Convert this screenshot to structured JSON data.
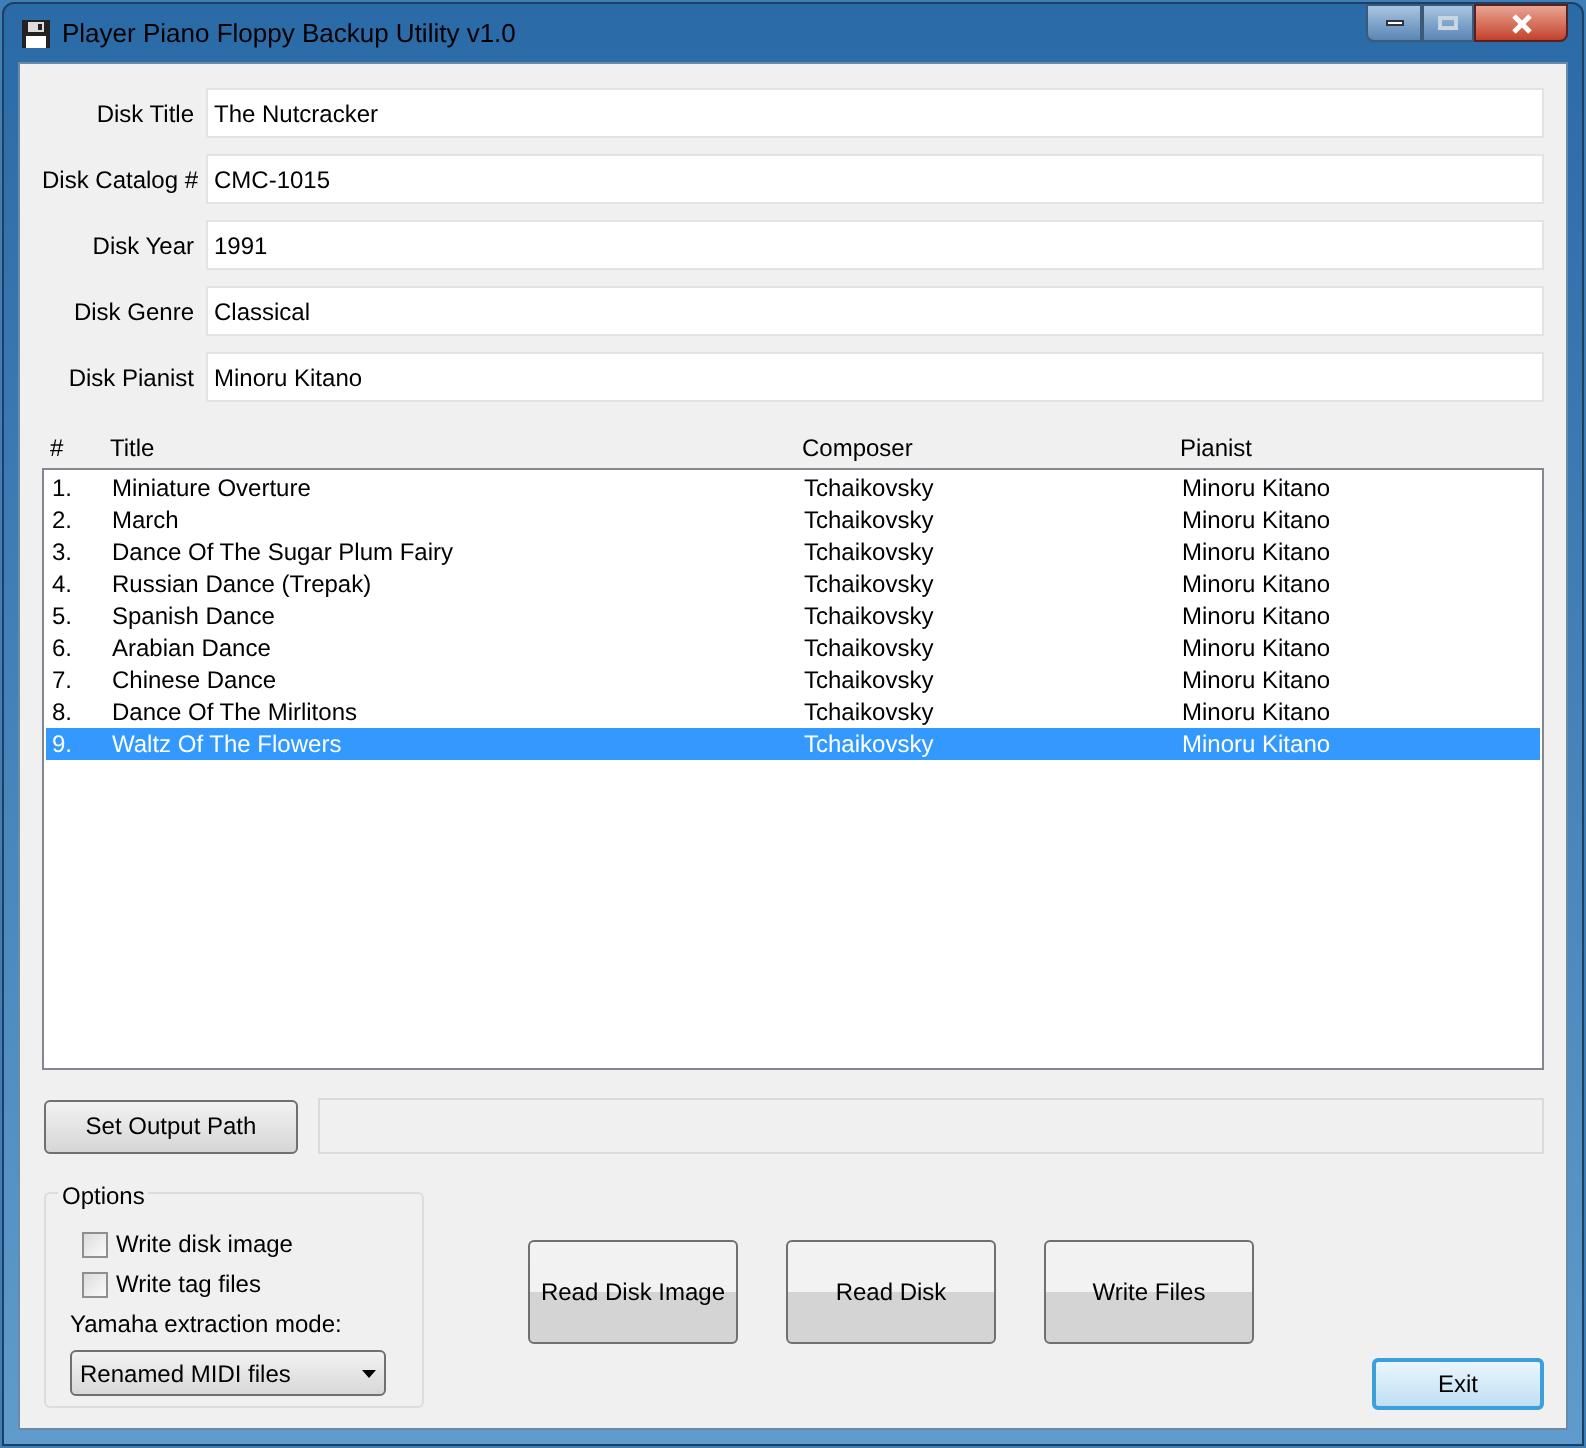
{
  "window": {
    "title": "Player Piano Floppy Backup Utility v1.0"
  },
  "fields": [
    {
      "label": "Disk Title",
      "value": "The Nutcracker"
    },
    {
      "label": "Disk Catalog #",
      "value": "CMC-1015"
    },
    {
      "label": "Disk Year",
      "value": "1991"
    },
    {
      "label": "Disk Genre",
      "value": "Classical"
    },
    {
      "label": "Disk Pianist",
      "value": "Minoru Kitano"
    }
  ],
  "table": {
    "columns": [
      "#",
      "Title",
      "Composer",
      "Pianist"
    ],
    "rows": [
      {
        "cells": [
          "1.",
          "Miniature Overture",
          "Tchaikovsky",
          "Minoru Kitano"
        ],
        "selected": false
      },
      {
        "cells": [
          "2.",
          "March",
          "Tchaikovsky",
          "Minoru Kitano"
        ],
        "selected": false
      },
      {
        "cells": [
          "3.",
          "Dance Of The Sugar Plum Fairy",
          "Tchaikovsky",
          "Minoru Kitano"
        ],
        "selected": false
      },
      {
        "cells": [
          "4.",
          "Russian Dance (Trepak)",
          "Tchaikovsky",
          "Minoru Kitano"
        ],
        "selected": false
      },
      {
        "cells": [
          "5.",
          "Spanish Dance",
          "Tchaikovsky",
          "Minoru Kitano"
        ],
        "selected": false
      },
      {
        "cells": [
          "6.",
          "Arabian Dance",
          "Tchaikovsky",
          "Minoru Kitano"
        ],
        "selected": false
      },
      {
        "cells": [
          "7.",
          "Chinese Dance",
          "Tchaikovsky",
          "Minoru Kitano"
        ],
        "selected": false
      },
      {
        "cells": [
          "8.",
          "Dance Of The Mirlitons",
          "Tchaikovsky",
          "Minoru Kitano"
        ],
        "selected": false
      },
      {
        "cells": [
          "9.",
          "Waltz Of The Flowers",
          "Tchaikovsky",
          "Minoru Kitano"
        ],
        "selected": true
      }
    ]
  },
  "output": {
    "button": "Set Output Path"
  },
  "options": {
    "title": "Options",
    "checkboxes": [
      {
        "label": "Write disk image",
        "checked": false
      },
      {
        "label": "Write tag files",
        "checked": false
      }
    ],
    "mode_label": "Yamaha extraction mode:",
    "mode_value": "Renamed MIDI files"
  },
  "actions": [
    "Read Disk Image",
    "Read Disk",
    "Write Files"
  ],
  "exit": {
    "label": "Exit",
    "focused": true
  }
}
